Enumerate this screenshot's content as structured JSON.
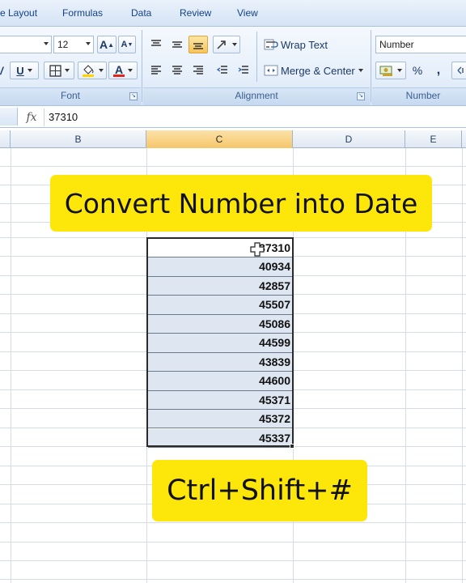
{
  "ribbon": {
    "tabs": [
      "e Layout",
      "Formulas",
      "Data",
      "Review",
      "View"
    ],
    "font": {
      "size": "12",
      "grow_glyph": "A",
      "shrink_glyph": "A",
      "underline_glyph": "U",
      "font_color_glyph": "A",
      "group_label": "Font"
    },
    "alignment": {
      "wrap_text": "Wrap Text",
      "merge_center": "Merge & Center",
      "group_label": "Alignment"
    },
    "number": {
      "format": "Number",
      "percent": "%",
      "comma": ",",
      "group_label": "Number"
    },
    "launcher_glyph": "↘",
    "colors": {
      "fill": "#ffd200",
      "font_color": "#e0251b"
    }
  },
  "formula_bar": {
    "fx_label": "fx",
    "value": "37310"
  },
  "sheet": {
    "columns": [
      "B",
      "C",
      "D",
      "E"
    ],
    "selected_column": "C",
    "values": [
      "37310",
      "40934",
      "42857",
      "45507",
      "45086",
      "44599",
      "43839",
      "44600",
      "45371",
      "45372",
      "45337"
    ]
  },
  "banners": {
    "top": "Convert Number into Date",
    "bottom": "Ctrl+Shift+#"
  },
  "colors": {
    "banner": "#fde70a",
    "selection_header": "#f6c56a"
  }
}
